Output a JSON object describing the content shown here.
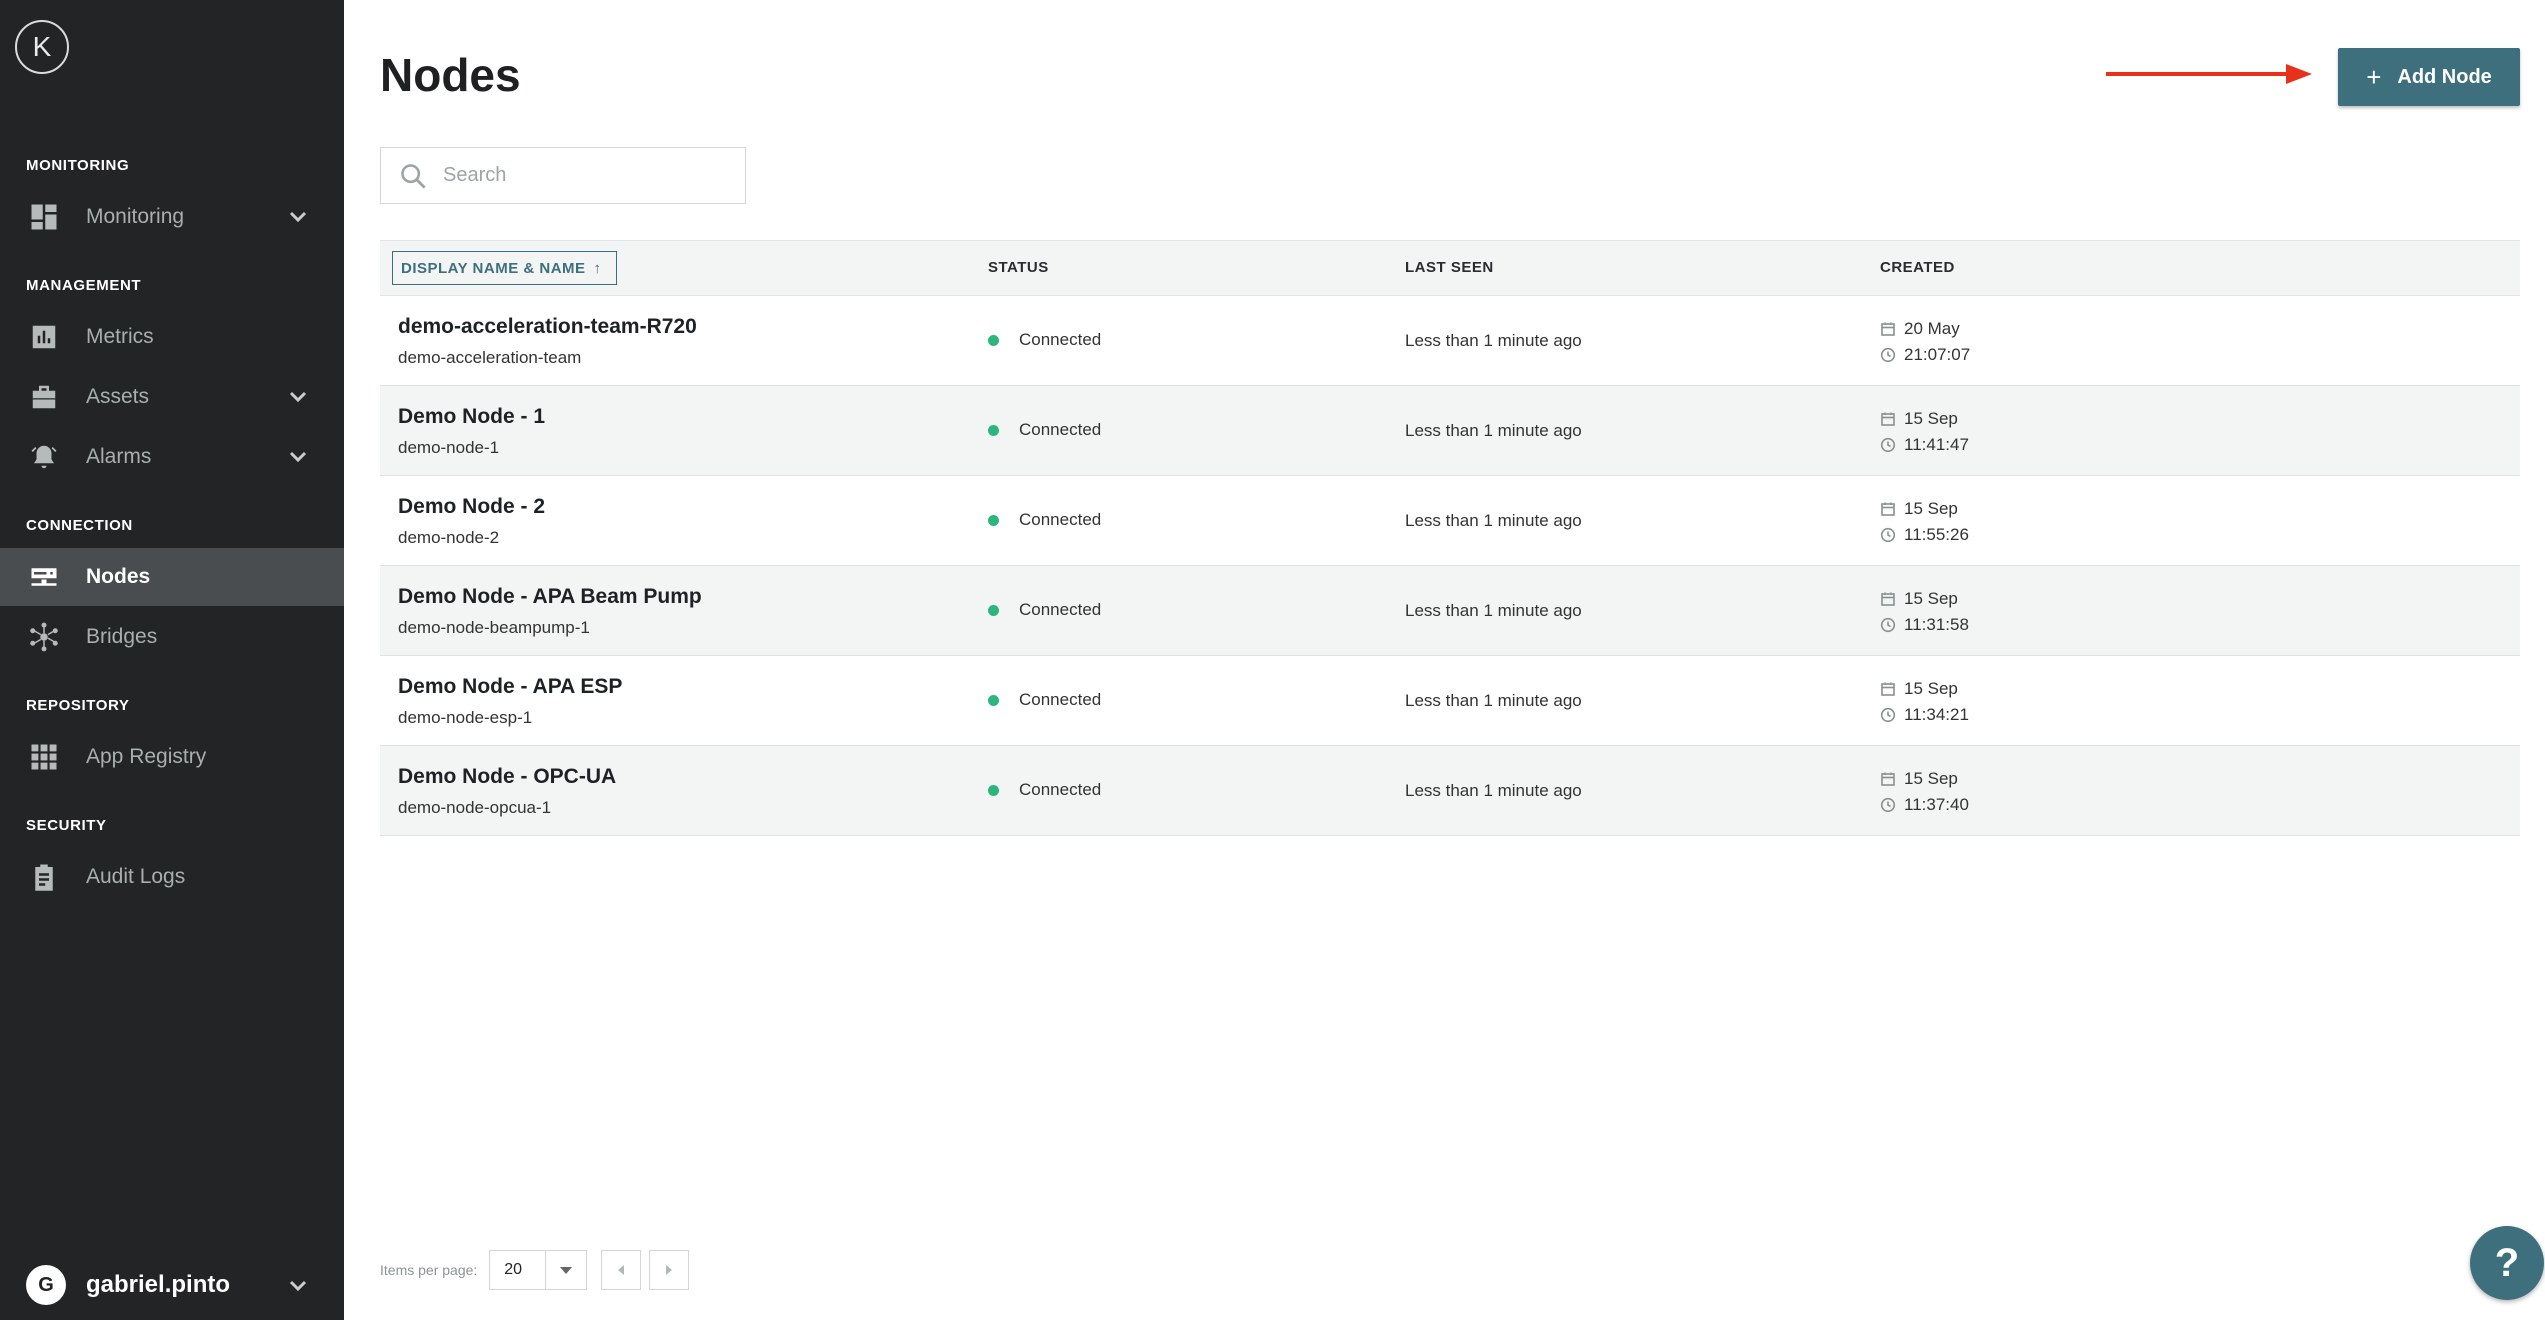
{
  "colors": {
    "sidebar_bg": "#222425",
    "sidebar_active_bg": "#4a4d4f",
    "accent": "#3d6f7c",
    "status_connected": "#2cb67d",
    "annotation_arrow": "#e8311a"
  },
  "sidebar": {
    "logo": "K",
    "sections": {
      "monitoring": "MONITORING",
      "management": "MANAGEMENT",
      "connection": "CONNECTION",
      "repository": "REPOSITORY",
      "security": "SECURITY"
    },
    "items": {
      "monitoring": {
        "label": "Monitoring",
        "icon": "dashboard-icon"
      },
      "metrics": {
        "label": "Metrics",
        "icon": "bar-chart-icon"
      },
      "assets": {
        "label": "Assets",
        "icon": "briefcase-icon"
      },
      "alarms": {
        "label": "Alarms",
        "icon": "alarm-bell-icon"
      },
      "nodes": {
        "label": "Nodes",
        "icon": "server-icon",
        "active": true
      },
      "bridges": {
        "label": "Bridges",
        "icon": "network-hub-icon"
      },
      "app_registry": {
        "label": "App Registry",
        "icon": "grid-icon"
      },
      "audit_logs": {
        "label": "Audit Logs",
        "icon": "clipboard-icon"
      }
    },
    "user": {
      "initial": "G",
      "name": "gabriel.pinto"
    }
  },
  "header": {
    "title": "Nodes",
    "add_button": "Add Node"
  },
  "search": {
    "placeholder": "Search",
    "value": ""
  },
  "table": {
    "columns": {
      "name": "DISPLAY NAME & NAME",
      "status": "STATUS",
      "last_seen": "LAST SEEN",
      "created": "CREATED"
    },
    "sort_indicator": "↑",
    "rows": [
      {
        "display_name": "demo-acceleration-team-R720",
        "name": "demo-acceleration-team",
        "status": "Connected",
        "last_seen": "Less than 1 minute ago",
        "created_date": "20 May",
        "created_time": "21:07:07"
      },
      {
        "display_name": "Demo Node - 1",
        "name": "demo-node-1",
        "status": "Connected",
        "last_seen": "Less than 1 minute ago",
        "created_date": "15 Sep",
        "created_time": "11:41:47"
      },
      {
        "display_name": "Demo Node - 2",
        "name": "demo-node-2",
        "status": "Connected",
        "last_seen": "Less than 1 minute ago",
        "created_date": "15 Sep",
        "created_time": "11:55:26"
      },
      {
        "display_name": "Demo Node - APA Beam Pump",
        "name": "demo-node-beampump-1",
        "status": "Connected",
        "last_seen": "Less than 1 minute ago",
        "created_date": "15 Sep",
        "created_time": "11:31:58"
      },
      {
        "display_name": "Demo Node - APA ESP",
        "name": "demo-node-esp-1",
        "status": "Connected",
        "last_seen": "Less than 1 minute ago",
        "created_date": "15 Sep",
        "created_time": "11:34:21"
      },
      {
        "display_name": "Demo Node - OPC-UA",
        "name": "demo-node-opcua-1",
        "status": "Connected",
        "last_seen": "Less than 1 minute ago",
        "created_date": "15 Sep",
        "created_time": "11:37:40"
      }
    ]
  },
  "pagination": {
    "label": "Items per page:",
    "per_page": "20"
  },
  "help_button": "?"
}
